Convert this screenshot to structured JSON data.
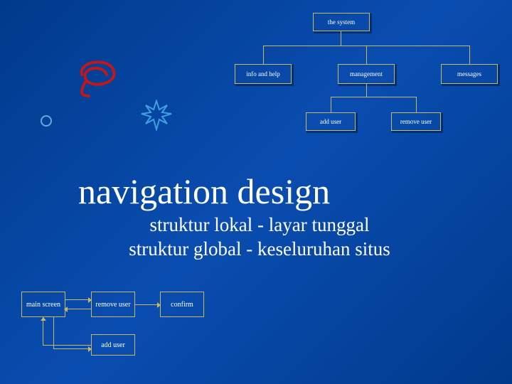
{
  "tree": {
    "root": "the system",
    "level1": {
      "a": "info and help",
      "b": "management",
      "c": "messages"
    },
    "level2": {
      "a": "add user",
      "b": "remove user"
    }
  },
  "title": "navigation design",
  "subtitle_line1": "struktur lokal - layar tunggal",
  "subtitle_line2": "struktur global - keseluruhan situs",
  "flow": {
    "a": "main screen",
    "b": "remove user",
    "c": "confirm",
    "d": "add user"
  }
}
